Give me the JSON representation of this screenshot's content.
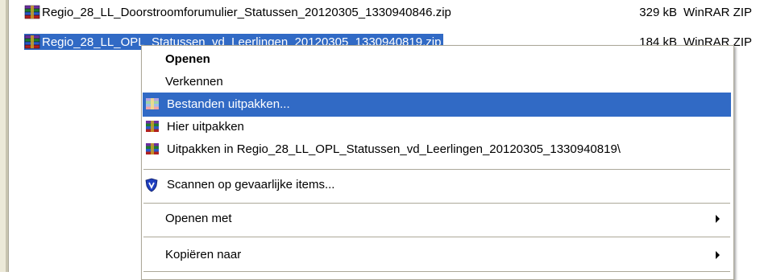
{
  "files": [
    {
      "name": "Regio_28_LL_Doorstroomforumulier_Statussen_20120305_1330940846.zip",
      "size": "329 kB",
      "type": "WinRAR ZIP",
      "selected": false
    },
    {
      "name": "Regio_28_LL_OPL_Statussen_vd_Leerlingen_20120305_1330940819.zip",
      "size": "184 kB",
      "type": "WinRAR ZIP",
      "selected": true
    }
  ],
  "context_menu": {
    "items": [
      {
        "label": "Openen",
        "icon": null,
        "bold": true
      },
      {
        "label": "Verkennen",
        "icon": null
      },
      {
        "label": "Bestanden uitpakken...",
        "icon": "winrar-extract-icon",
        "highlighted": true
      },
      {
        "label": "Hier uitpakken",
        "icon": "winrar-icon"
      },
      {
        "label": "Uitpakken in Regio_28_LL_OPL_Statussen_vd_Leerlingen_20120305_1330940819\\",
        "icon": "winrar-icon"
      },
      {
        "label": "Scannen op gevaarlijke items...",
        "icon": "shield-icon"
      },
      {
        "label": "Openen met",
        "icon": null,
        "submenu": true
      },
      {
        "label": "Kopiëren naar",
        "icon": null,
        "submenu": true
      }
    ]
  },
  "colors": {
    "selection": "#316ac5",
    "menu_border": "#aca899",
    "shield": "#1f3fbf"
  }
}
